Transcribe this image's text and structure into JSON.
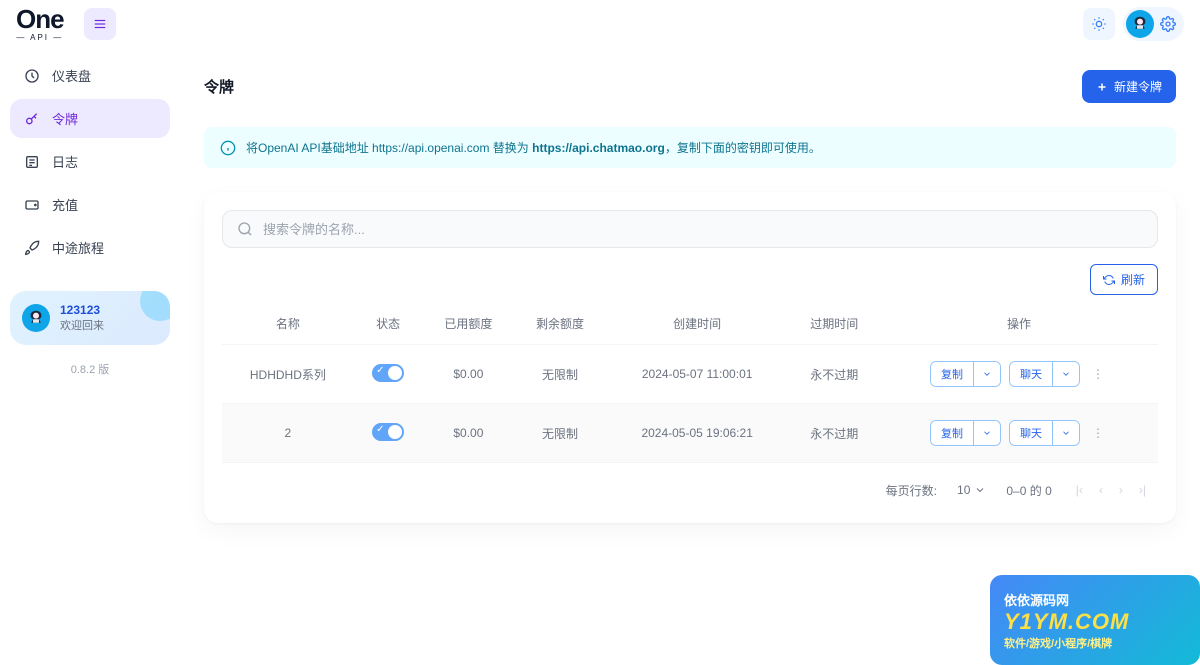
{
  "brand": {
    "name": "One",
    "sub": "— API —"
  },
  "header": {
    "theme_icon": "sun",
    "settings_icon": "gear"
  },
  "sidebar": {
    "items": [
      {
        "icon": "dashboard",
        "label": "仪表盘"
      },
      {
        "icon": "key",
        "label": "令牌"
      },
      {
        "icon": "log",
        "label": "日志"
      },
      {
        "icon": "wallet",
        "label": "充值"
      },
      {
        "icon": "rocket",
        "label": "中途旅程"
      }
    ],
    "user": {
      "name": "123123",
      "welcome": "欢迎回来"
    },
    "version": "0.8.2 版"
  },
  "page": {
    "title": "令牌",
    "new_button": "新建令牌",
    "banner_pre": "将OpenAI API基础地址 https://api.openai.com 替换为 ",
    "banner_url": "https://api.chatmao.org",
    "banner_post": "，复制下面的密钥即可使用。",
    "search_placeholder": "搜索令牌的名称...",
    "refresh": "刷新",
    "columns": [
      "名称",
      "状态",
      "已用额度",
      "剩余额度",
      "创建时间",
      "过期时间",
      "操作"
    ],
    "rows": [
      {
        "name": "HDHDHD系列",
        "used": "$0.00",
        "remain": "无限制",
        "created": "2024-05-07 11:00:01",
        "expire": "永不过期"
      },
      {
        "name": "2",
        "used": "$0.00",
        "remain": "无限制",
        "created": "2024-05-05 19:06:21",
        "expire": "永不过期"
      }
    ],
    "actions": {
      "copy": "复制",
      "chat": "聊天"
    },
    "pagination": {
      "rows_label": "每页行数:",
      "page_size": "10",
      "range": "0–0 的 0"
    }
  },
  "watermark": {
    "title": "依依源码网",
    "url": "Y1YM.COM",
    "sub": "软件/游戏/小程序/棋牌"
  }
}
